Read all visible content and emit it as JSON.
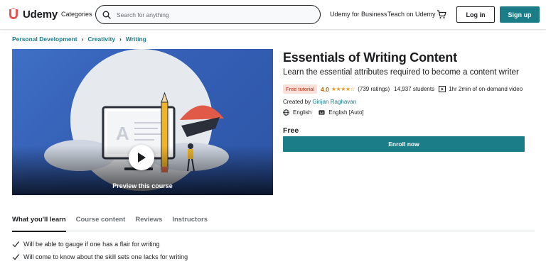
{
  "header": {
    "logo_text": "Udemy",
    "categories_label": "Categories",
    "search_placeholder": "Search for anything",
    "business_link": "Udemy for Business",
    "teach_link": "Teach on Udemy",
    "login_label": "Log in",
    "signup_label": "Sign up"
  },
  "breadcrumb": [
    "Personal Development",
    "Creativity",
    "Writing"
  ],
  "preview": {
    "label": "Preview this course"
  },
  "course": {
    "title": "Essentials of Writing Content",
    "subtitle": "Learn the essential attributes required to become a content writer",
    "badge": "Free tutorial",
    "rating": "4.0",
    "rating_stars": 4,
    "ratings_count": "(739 ratings)",
    "students": "14,937 students",
    "video_length": "1hr 2min of on-demand video",
    "created_by_label": "Created by",
    "author": "Girijan Raghavan",
    "language": "English",
    "captions": "English [Auto]",
    "price": "Free",
    "enroll_label": "Enroll now"
  },
  "tabs": [
    "What you'll learn",
    "Course content",
    "Reviews",
    "Instructors"
  ],
  "learn_items": [
    "Will be able to gauge if one has a flair for writing",
    "Will come to know about the skill sets one lacks for writing"
  ],
  "colors": {
    "brand_red": "#a435f0",
    "teal": "#1b7d87",
    "rating_gold": "#b4690e",
    "star": "#e59819",
    "badge_bg": "#fbe0d9",
    "badge_text": "#b32d0f"
  },
  "icons": {
    "search": "search-icon",
    "cart": "cart-icon",
    "play": "play-icon",
    "video": "video-icon",
    "globe": "globe-icon",
    "captions": "captions-icon",
    "check": "check-icon"
  }
}
